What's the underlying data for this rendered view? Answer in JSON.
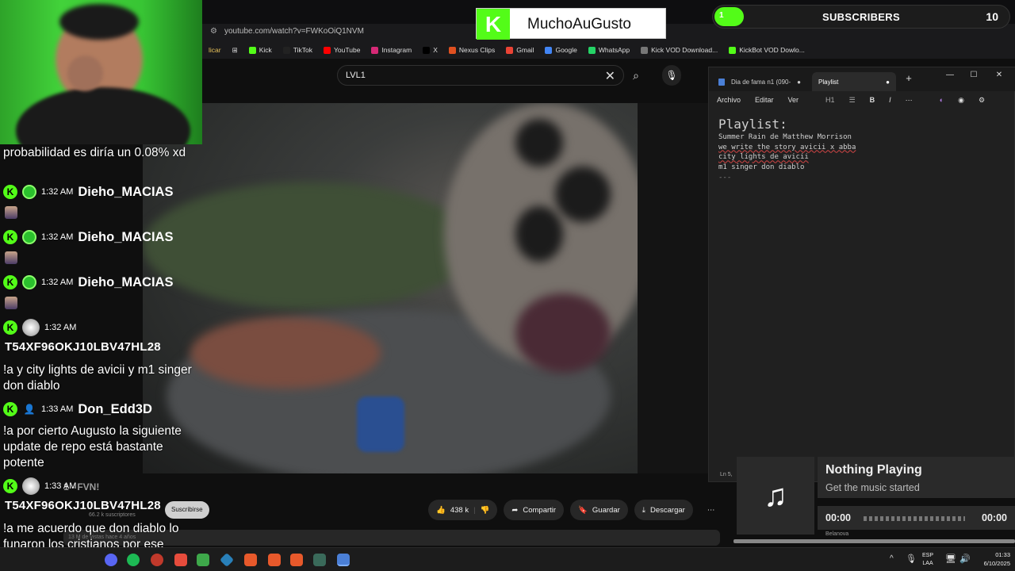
{
  "browser": {
    "url": "youtube.com/watch?v=FWKoOiQ1NVM",
    "partial_text": "licar",
    "bookmarks": [
      {
        "label": "Kick",
        "color": "#53fc18"
      },
      {
        "label": "TikTok",
        "color": "#222222"
      },
      {
        "label": "YouTube",
        "color": "#ff0000"
      },
      {
        "label": "Instagram",
        "color": "#d62976"
      },
      {
        "label": "X",
        "color": "#000000"
      },
      {
        "label": "Nexus Clips",
        "color": "#e05020"
      },
      {
        "label": "Gmail",
        "color": "#ea4335"
      },
      {
        "label": "Google",
        "color": "#4285f4"
      },
      {
        "label": "WhatsApp",
        "color": "#25d366"
      },
      {
        "label": "Kick VOD Download...",
        "color": "#777777"
      },
      {
        "label": "KickBot VOD Dowlo...",
        "color": "#53fc18"
      }
    ]
  },
  "youtube": {
    "search_value": "LVL1",
    "channel_partial": "1 - FVN!",
    "subscribe_label": "Suscribirse",
    "subscribers": "66.2 k suscriptores",
    "views_line": "13 M de vistas hace 4 años",
    "actions": {
      "likes": "438 k",
      "share": "Compartir",
      "save": "Guardar",
      "download": "Descargar"
    }
  },
  "brand": {
    "logo_letter": "K",
    "name": "MuchoAuGusto"
  },
  "sub_goal": {
    "current": "1",
    "label": "SUBSCRIBERS",
    "goal": "10",
    "progress": 0.1
  },
  "chat": {
    "m0": "probabilidad es diría un 0.08% xd",
    "rows": [
      {
        "time": "1:32 AM",
        "user": "Dieho_MACIAS"
      },
      {
        "time": "1:32 AM",
        "user": "Dieho_MACIAS"
      },
      {
        "time": "1:32 AM",
        "user": "Dieho_MACIAS"
      }
    ],
    "m4_time": "1:32 AM",
    "m4_user": "T54XF96OKJ10LBV47HL28",
    "m4_text": "!a y city lights de avicii y m1 singer don diablo",
    "m5_time": "1:33 AM",
    "m5_user": "Don_Edd3D",
    "m5_text": "!a por cierto Augusto la siguiente update de repo está bastante potente",
    "m6_time": "1:33 AM",
    "m6_user": "T54XF96OKJ10LBV47HL28",
    "m6_text": "!a me acuerdo que don diablo lo funaron los cristianos por ese nombre xd"
  },
  "notepad": {
    "tab1": "Dia de fama n1 (090-",
    "tab2": "Playlist",
    "menu": [
      "Archivo",
      "Editar",
      "Ver"
    ],
    "heading_style": "H1",
    "heading": "Playlist:",
    "lines": [
      "Summer Rain de Matthew Morrison",
      "we write the story avicii x abba",
      "city lights de avicii",
      "m1 singer don diablo",
      "---"
    ],
    "status": "Ln 5,"
  },
  "now_playing": {
    "title": "Nothing Playing",
    "subtitle": "Get the music started",
    "time_start": "00:00",
    "time_end": "00:00",
    "under_text": "Belanova"
  },
  "taskbar": {
    "lang1": "ESP",
    "lang2": "LAA",
    "time": "01:33",
    "date": "6/10/2025"
  }
}
